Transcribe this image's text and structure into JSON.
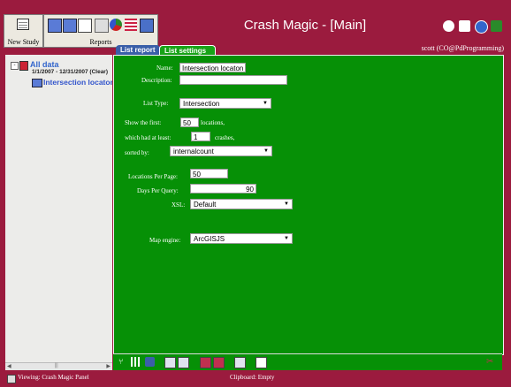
{
  "header": {
    "title": "Crash Magic - [Main]",
    "user": "scott (CO@PdProgramming)",
    "new_study_label": "New Study",
    "reports_label": "Reports"
  },
  "tabs": {
    "list_report": "List report",
    "list_settings": "List settings"
  },
  "tree": {
    "root_label": "All data",
    "date_range": "1/1/2007 - 12/31/2007 (Clear)",
    "item_label": "Intersection locaton"
  },
  "form": {
    "name_label": "Name:",
    "name_value": "Intersection locaton",
    "description_label": "Description:",
    "description_value": "",
    "list_type_label": "List Type:",
    "list_type_value": "Intersection",
    "show_first_label": "Show the first:",
    "show_first_value": "50",
    "locations_label": "locations,",
    "which_had_label": "which had at least:",
    "which_had_value": "1",
    "crashes_label": "crashes,",
    "sorted_by_label": "sorted by:",
    "sorted_by_value": "internalcount",
    "locations_per_page_label": "Locations Per Page:",
    "locations_per_page_value": "50",
    "days_per_query_label": "Days Per Query:",
    "days_per_query_value": "90",
    "xsl_label": "XSL:",
    "xsl_value": "Default",
    "map_engine_label": "Map engine:",
    "map_engine_value": "ArcGISJS"
  },
  "status": {
    "viewing": "Viewing: Crash Magic Panel",
    "clipboard": "Clipboard: Empty"
  },
  "colors": {
    "frame": "#9b1b3e",
    "panel": "#069006",
    "tab_active": "#17a317",
    "tab_inactive": "#3a5fa8"
  }
}
